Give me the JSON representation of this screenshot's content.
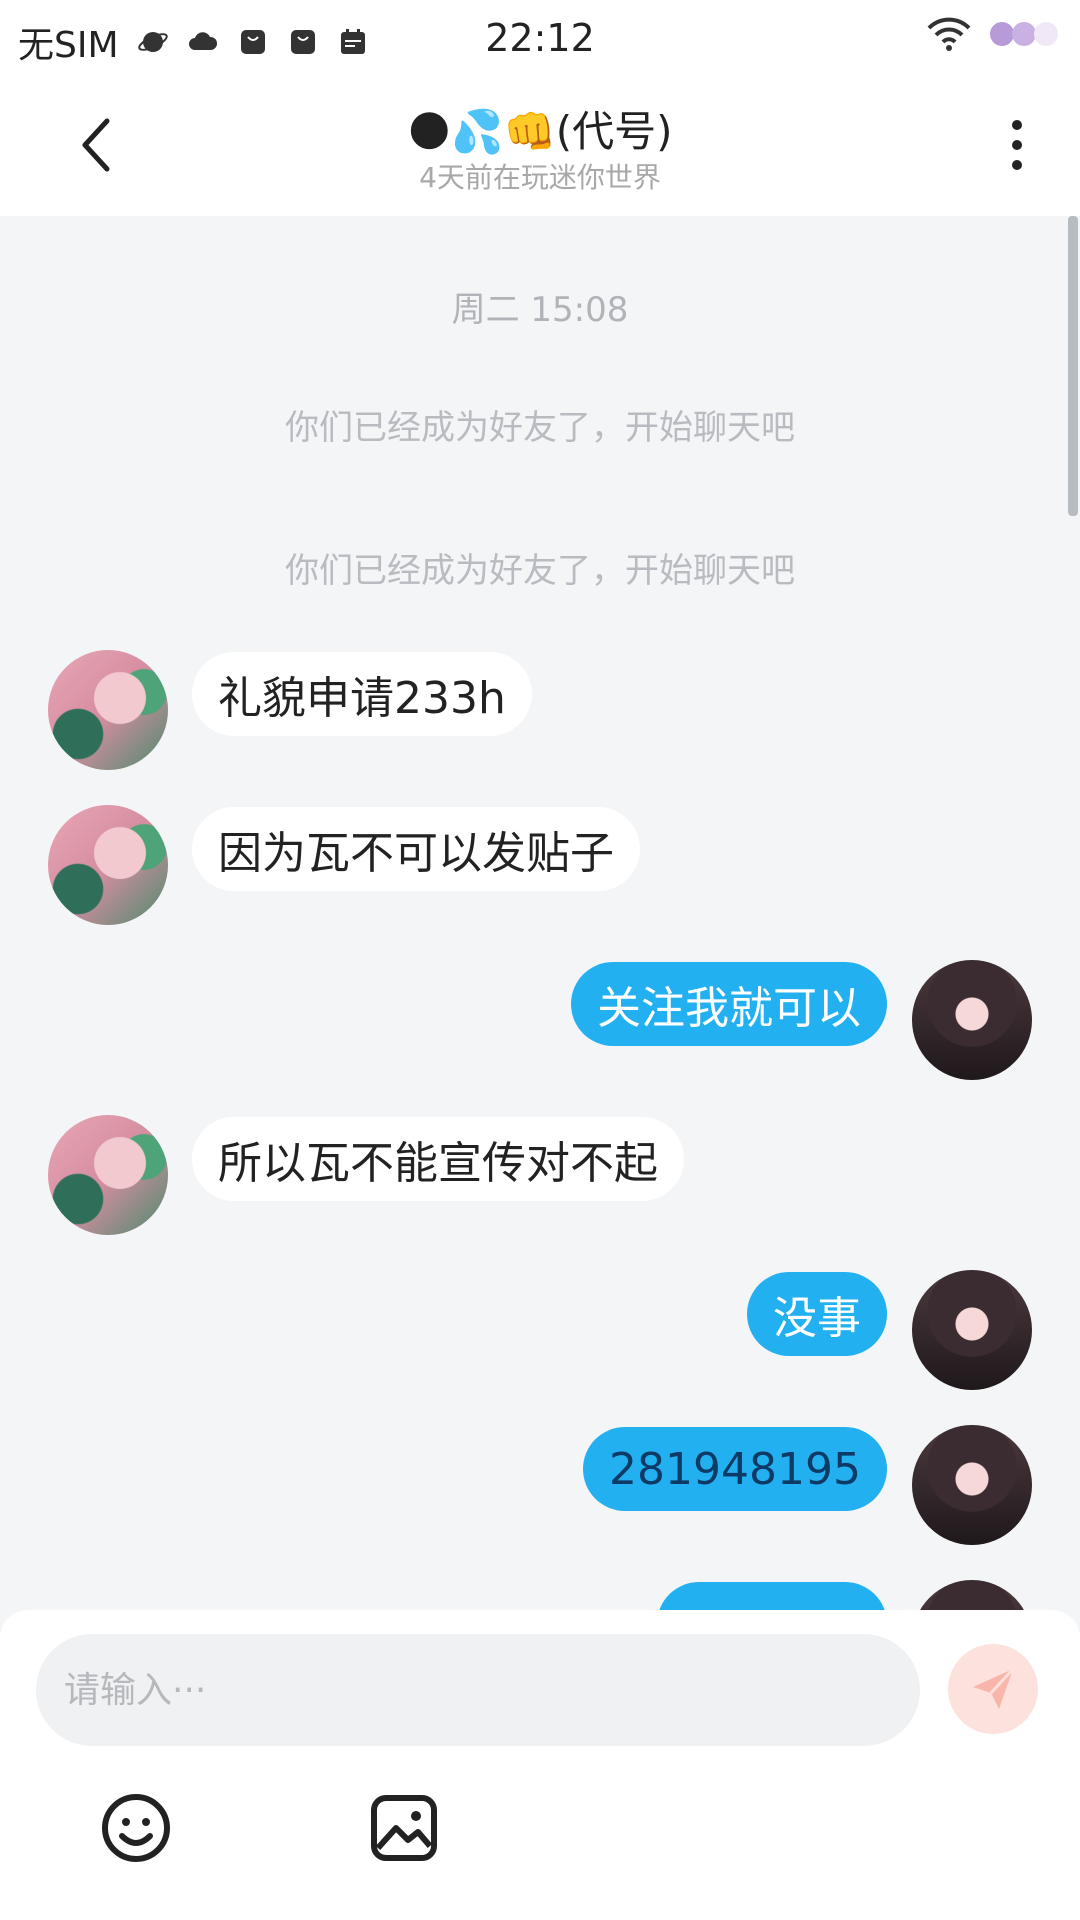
{
  "status_bar": {
    "carrier": "无SIM",
    "time": "22:12",
    "icons_left": [
      "planet-icon",
      "cloud-icon",
      "bag-icon",
      "bag-icon",
      "calendar-icon"
    ],
    "icons_right": [
      "wifi-icon",
      "avatar-badges-icon"
    ]
  },
  "header": {
    "title": "🌑💦👊(代号)",
    "subtitle": "4天前在玩迷你世界",
    "back_icon": "chevron-left-icon",
    "more_icon": "more-vertical-icon"
  },
  "chat": {
    "time_label": "周二 15:08",
    "system_messages": [
      "你们已经成为好友了，开始聊天吧",
      "你们已经成为好友了，开始聊天吧"
    ],
    "messages": [
      {
        "side": "in",
        "text": "礼貌申请233h"
      },
      {
        "side": "in",
        "text": "因为瓦不可以发贴子"
      },
      {
        "side": "out",
        "text": "关注我就可以"
      },
      {
        "side": "in",
        "text": "所以瓦不能宣传对不起"
      },
      {
        "side": "out",
        "text": "没事"
      },
      {
        "side": "out",
        "text": "281948195"
      }
    ]
  },
  "input": {
    "placeholder": "请输入···",
    "value": ""
  },
  "colors": {
    "accent": "#23b0f0",
    "background": "#f3f5f7",
    "send_button": "#fde1dc"
  }
}
